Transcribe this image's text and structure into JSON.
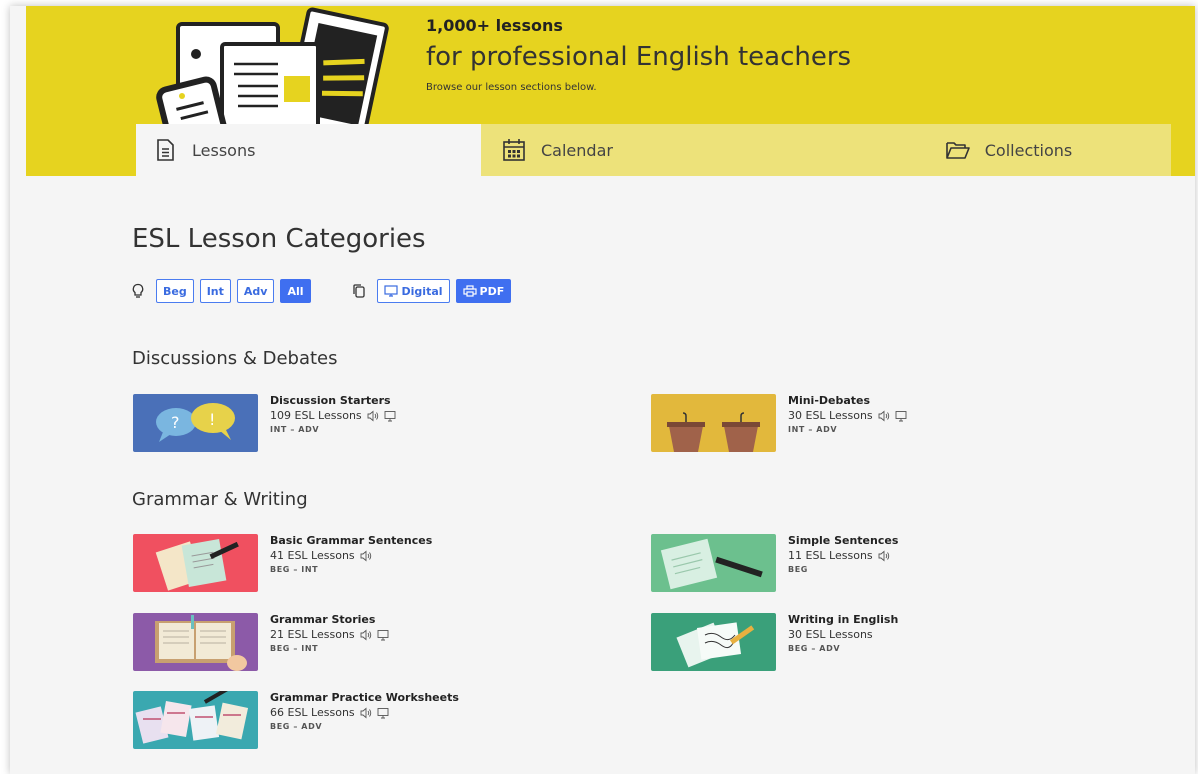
{
  "hero": {
    "title": "1,000+ lessons",
    "subtitle": "for professional English teachers",
    "note": "Browse our lesson sections below.",
    "bg_color": "#e6d31f"
  },
  "tabs": [
    {
      "label": "Lessons",
      "icon": "document-icon",
      "active": true
    },
    {
      "label": "Calendar",
      "icon": "calendar-icon",
      "active": false
    },
    {
      "label": "Collections",
      "icon": "folder-icon",
      "active": false
    }
  ],
  "page_title": "ESL Lesson Categories",
  "filters": {
    "level_icon": "lightbulb-icon",
    "levels": [
      "Beg",
      "Int",
      "Adv",
      "All"
    ],
    "selected_level": "All",
    "format_icon": "copy-icon",
    "formats": [
      "Digital",
      "PDF"
    ],
    "selected_format": "PDF",
    "accent_color": "#3f6ff0"
  },
  "sections": [
    {
      "title": "Discussions & Debates",
      "cards": [
        {
          "title": "Discussion Starters",
          "count": "109 ESL Lessons",
          "level": "INT – ADV",
          "audio": true,
          "digital": true,
          "thumb_color": "#4a70b8"
        },
        {
          "title": "Mini-Debates",
          "count": "30 ESL Lessons",
          "level": "INT – ADV",
          "audio": true,
          "digital": true,
          "thumb_color": "#e2b83c"
        }
      ]
    },
    {
      "title": "Grammar & Writing",
      "cards": [
        {
          "title": "Basic Grammar Sentences",
          "count": "41 ESL Lessons",
          "level": "BEG – INT",
          "audio": true,
          "digital": false,
          "thumb_color": "#f05060"
        },
        {
          "title": "Simple Sentences",
          "count": "11 ESL Lessons",
          "level": "BEG",
          "audio": true,
          "digital": false,
          "thumb_color": "#6cc08e"
        },
        {
          "title": "Grammar Stories",
          "count": "21 ESL Lessons",
          "level": "BEG – INT",
          "audio": true,
          "digital": true,
          "thumb_color": "#8c5aa8"
        },
        {
          "title": "Writing in English",
          "count": "30 ESL Lessons",
          "level": "BEG – ADV",
          "audio": false,
          "digital": false,
          "thumb_color": "#3aa07a"
        },
        {
          "title": "Grammar Practice Worksheets",
          "count": "66 ESL Lessons",
          "level": "BEG – ADV",
          "audio": true,
          "digital": true,
          "thumb_color": "#3aa8b0"
        }
      ]
    }
  ]
}
